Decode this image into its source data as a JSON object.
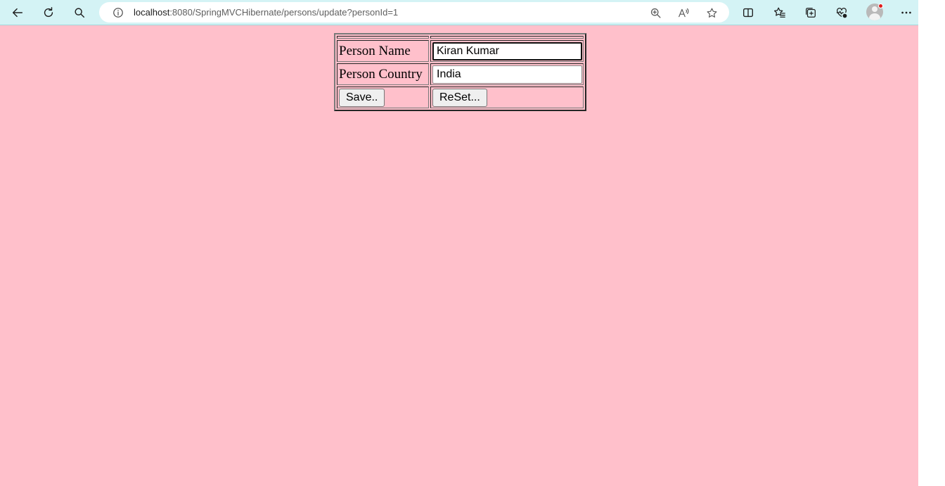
{
  "browser": {
    "url_host": "localhost",
    "url_rest": ":8080/SpringMVCHibernate/persons/update?personId=1",
    "toolbar_icons": [
      "back-icon",
      "refresh-icon",
      "search-icon",
      "info-icon",
      "zoom-icon",
      "read-aloud-icon",
      "favorite-star-icon",
      "split-screen-icon",
      "favorites-icon",
      "collections-icon",
      "performance-icon",
      "profile-avatar",
      "more-icon"
    ],
    "theme_color": "#d4f3f5"
  },
  "page": {
    "background": "#ffc0cb",
    "form": {
      "name_label": "Person Name",
      "name_value": "Kiran Kumar",
      "country_label": "Person Country",
      "country_value": "India",
      "save_label": "Save..",
      "reset_label": "ReSet..."
    }
  }
}
